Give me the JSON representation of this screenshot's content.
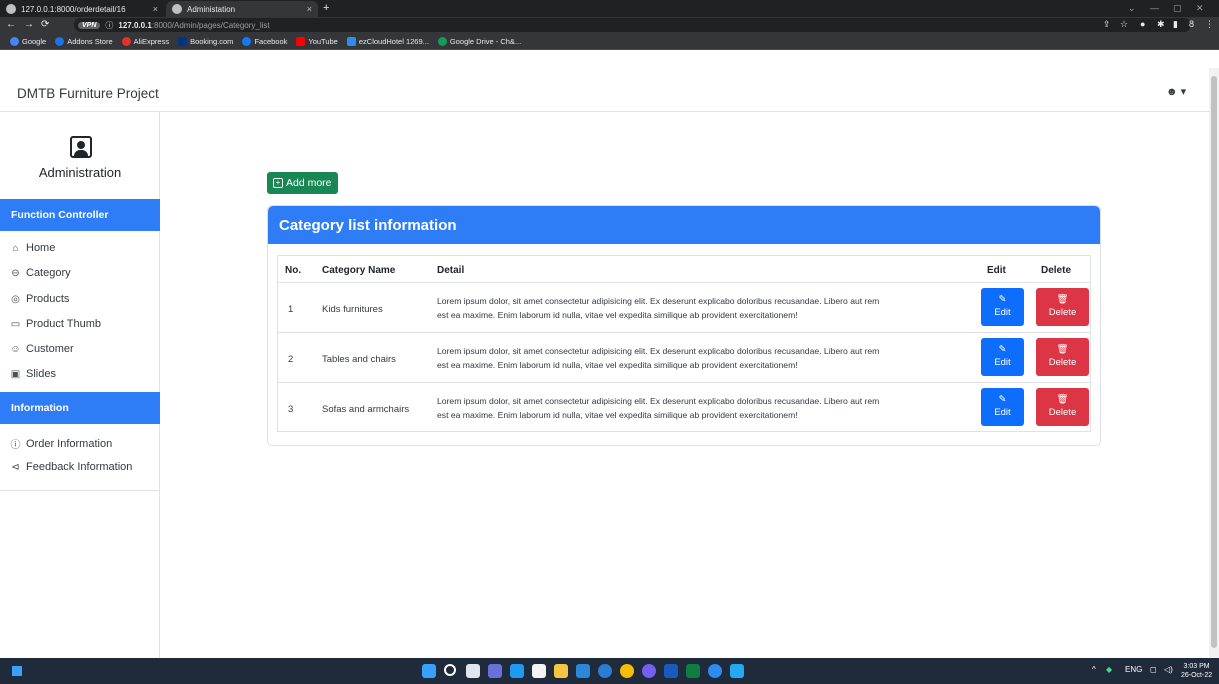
{
  "browser": {
    "tabs": [
      {
        "title": "127.0.0.1:8000/orderdetail/16",
        "active": false
      },
      {
        "title": "Administation",
        "active": true
      }
    ],
    "new_tab": "+",
    "tab_close": "×",
    "address": {
      "vpn": "VPN",
      "host": "127.0.0.1",
      "path": ":8000/Admin/pages/Category_list"
    },
    "bookmarks": [
      {
        "label": "Google",
        "icon": "google-icon",
        "color": "#4285f4"
      },
      {
        "label": "Addons Store",
        "icon": "addons-icon",
        "color": "#1a73e8"
      },
      {
        "label": "AliExpress",
        "icon": "aliexpress-icon",
        "color": "#e43225"
      },
      {
        "label": "Booking.com",
        "icon": "booking-icon",
        "color": "#003580"
      },
      {
        "label": "Facebook",
        "icon": "facebook-icon",
        "color": "#1877f2"
      },
      {
        "label": "YouTube",
        "icon": "youtube-icon",
        "color": "#ff0000"
      },
      {
        "label": "ezCloudHotel 1269...",
        "icon": "ezcloud-icon",
        "color": "#2d8cf0"
      },
      {
        "label": "Google Drive - Ch&...",
        "icon": "drive-icon",
        "color": "#0f9d58"
      }
    ]
  },
  "navbar": {
    "brand": "DMTB Furniture Project"
  },
  "sidebar": {
    "title": "Administration",
    "function_controller": "Function Controller",
    "items": [
      {
        "label": "Home",
        "icon": "⌂",
        "name": "home-icon"
      },
      {
        "label": "Category",
        "icon": "⊖",
        "name": "category-icon"
      },
      {
        "label": "Products",
        "icon": "◎",
        "name": "products-icon"
      },
      {
        "label": "Product Thumb",
        "icon": "▭",
        "name": "image-icon"
      },
      {
        "label": "Customer",
        "icon": "☺",
        "name": "customer-icon"
      },
      {
        "label": "Slides",
        "icon": "▣",
        "name": "slides-icon"
      }
    ],
    "information": "Information",
    "info_items": [
      {
        "label": "Order Information",
        "icon": "ⓘ",
        "name": "order-icon"
      },
      {
        "label": "Feedback Information",
        "icon": "⊲",
        "name": "feedback-icon"
      }
    ]
  },
  "main": {
    "add_more": "Add more",
    "card_title": "Category list information",
    "headers": {
      "no": "No.",
      "name": "Category Name",
      "detail": "Detail",
      "edit": "Edit",
      "delete": "Delete"
    },
    "rows": [
      {
        "no": "1",
        "name": "Kids furnitures",
        "detail_1": "Lorem ipsum dolor, sit amet consectetur adipisicing elit. Ex deserunt explicabo doloribus recusandae. Libero aut rem",
        "detail_2": "est ea maxime. Enim laborum id nulla, vitae vel expedita similique ab provident exercitationem!"
      },
      {
        "no": "2",
        "name": "Tables and chairs",
        "detail_1": "Lorem ipsum dolor, sit amet consectetur adipisicing elit. Ex deserunt explicabo doloribus recusandae. Libero aut rem",
        "detail_2": "est ea maxime. Enim laborum id nulla, vitae vel expedita similique ab provident exercitationem!"
      },
      {
        "no": "3",
        "name": "Sofas and armchairs",
        "detail_1": "Lorem ipsum dolor, sit amet consectetur adipisicing elit. Ex deserunt explicabo doloribus recusandae. Libero aut rem",
        "detail_2": "est ea maxime. Enim laborum id nulla, vitae vel expedita similique ab provident exercitationem!"
      }
    ],
    "edit_label": "Edit",
    "delete_label": "Delete"
  },
  "taskbar": {
    "lang": "ENG",
    "time": "3:03 PM",
    "date": "26-Oct-22"
  },
  "colors": {
    "primary": "#2e7df7",
    "success": "#198754",
    "danger": "#dc3545",
    "edit": "#0d6efd"
  }
}
